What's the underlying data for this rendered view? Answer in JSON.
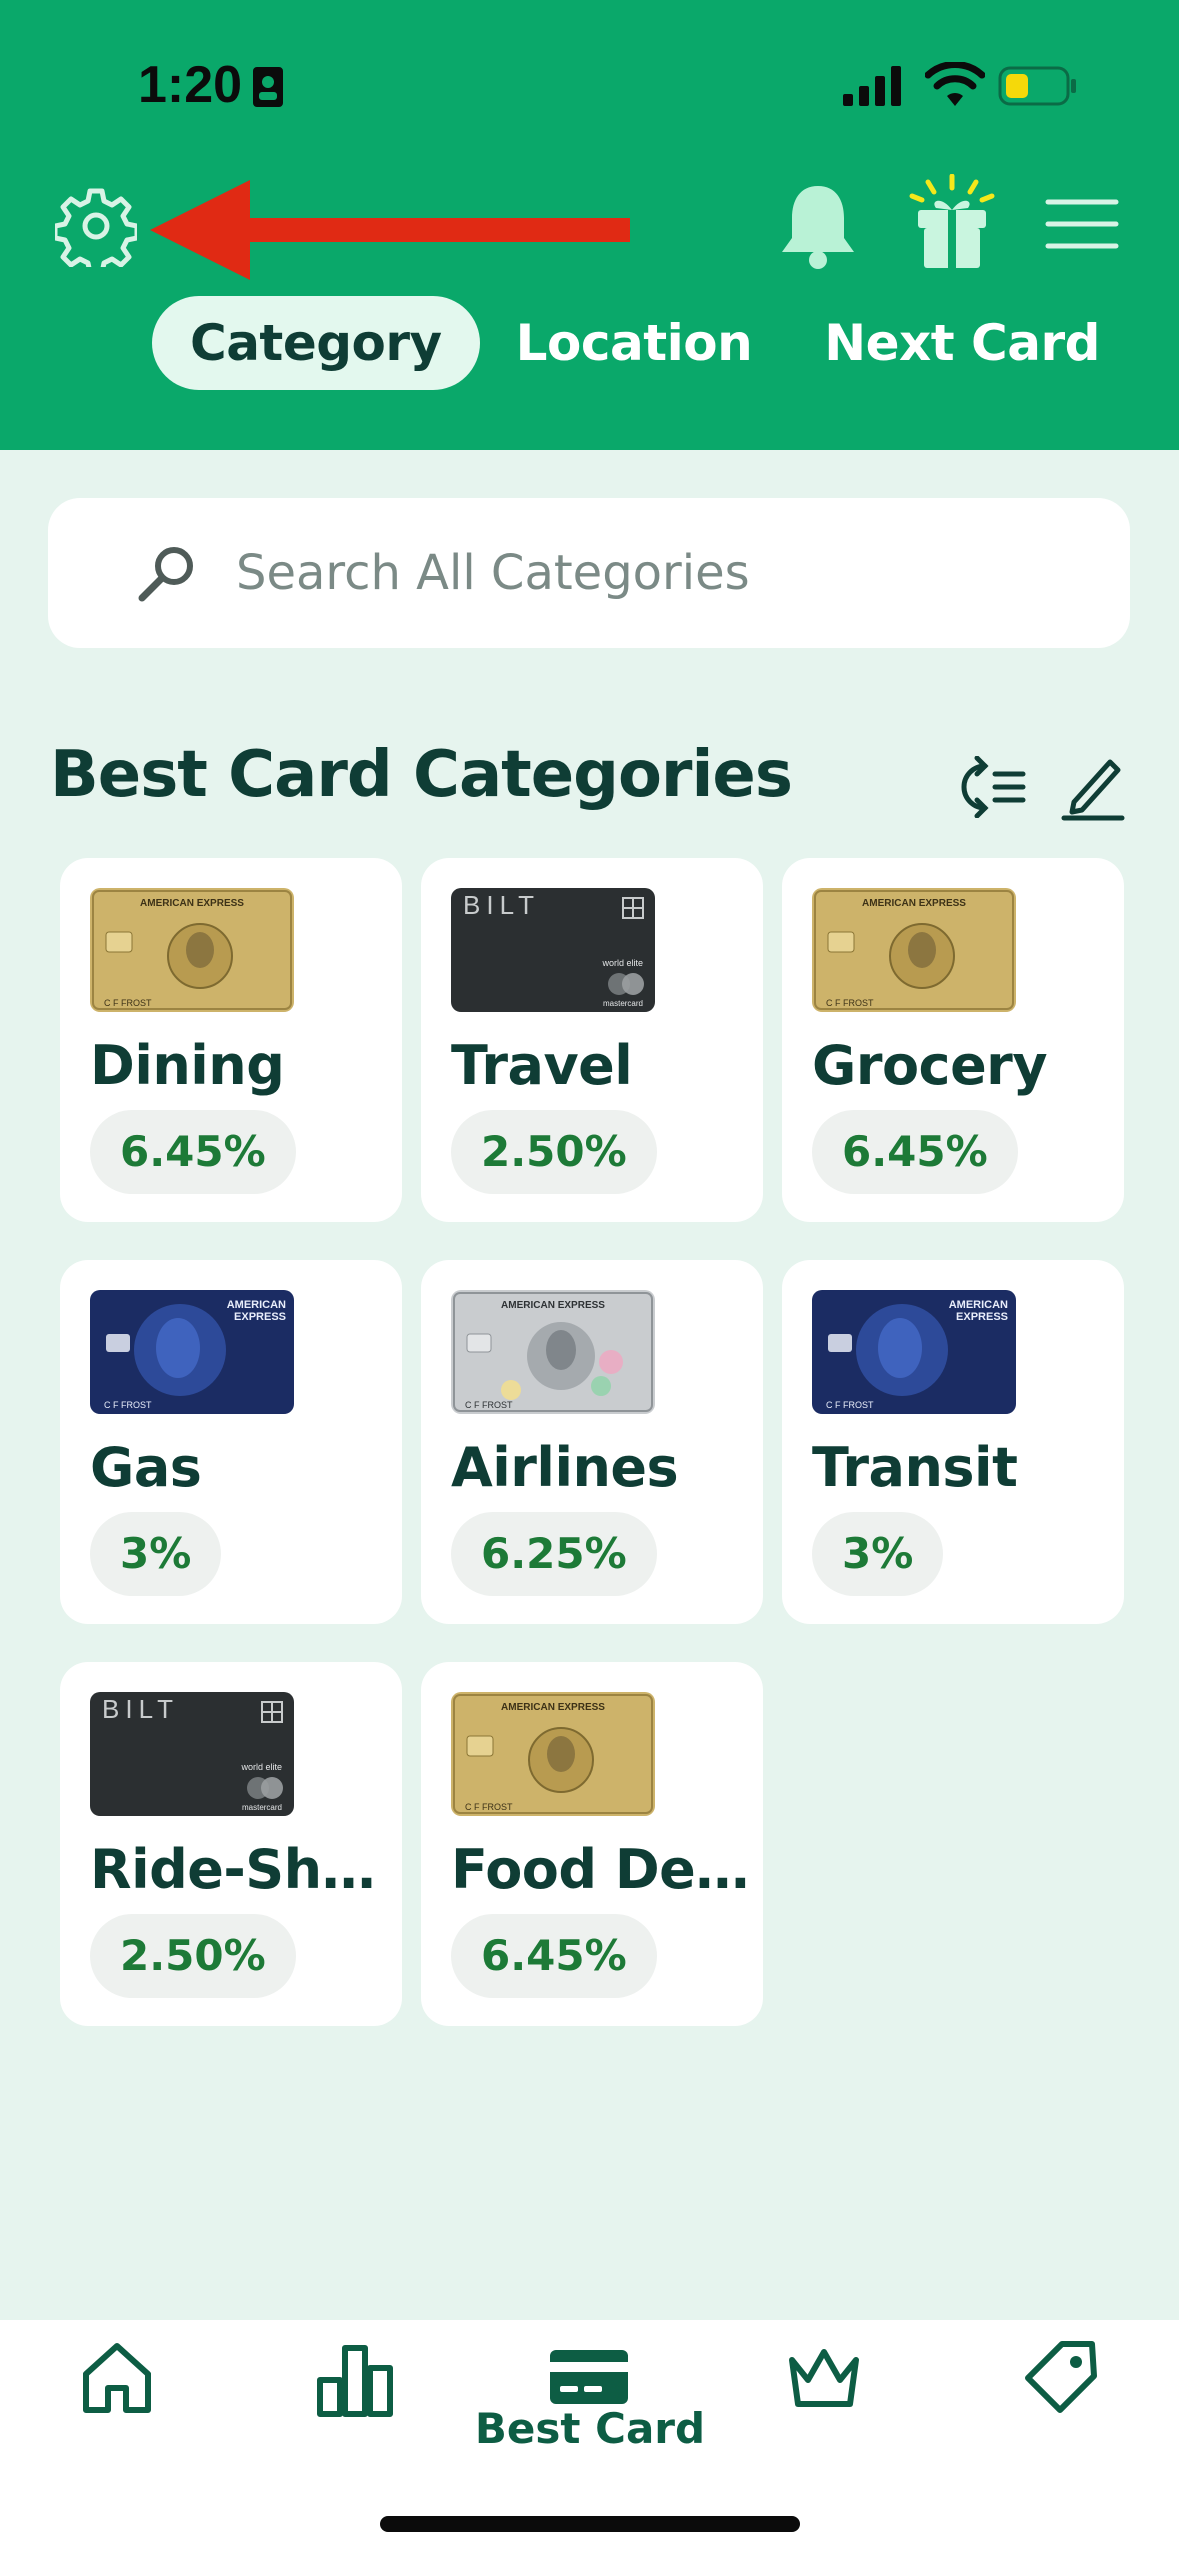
{
  "status_bar": {
    "time": "1:20"
  },
  "header": {
    "tabs": [
      {
        "label": "Category",
        "active": true
      },
      {
        "label": "Location",
        "active": false
      },
      {
        "label": "Next Card",
        "active": false
      }
    ]
  },
  "search": {
    "placeholder": "Search All Categories"
  },
  "section": {
    "title": "Best Card Categories"
  },
  "categories": [
    {
      "name": "Dining",
      "rate": "6.45%",
      "card": "amex-gold"
    },
    {
      "name": "Travel",
      "rate": "2.50%",
      "card": "bilt"
    },
    {
      "name": "Grocery",
      "rate": "6.45%",
      "card": "amex-gold"
    },
    {
      "name": "Gas",
      "rate": "3%",
      "card": "amex-blue"
    },
    {
      "name": "Airlines",
      "rate": "6.25%",
      "card": "amex-platinum"
    },
    {
      "name": "Transit",
      "rate": "3%",
      "card": "amex-blue"
    },
    {
      "name": "Ride-Sha…",
      "rate": "2.50%",
      "card": "bilt"
    },
    {
      "name": "Food Del…",
      "rate": "6.45%",
      "card": "amex-gold"
    }
  ],
  "card_art_text": {
    "amex": "AMERICAN EXPRESS",
    "bilt": "BILT",
    "bilt_tier": "world elite",
    "mastercard": "mastercard",
    "holder": "C F FROST"
  },
  "bottom_nav": {
    "items": [
      {
        "icon": "home-icon"
      },
      {
        "icon": "bar-chart-icon"
      },
      {
        "icon": "credit-card-icon",
        "label": "Best Card",
        "active": true
      },
      {
        "icon": "crown-icon"
      },
      {
        "icon": "tag-icon"
      }
    ]
  },
  "colors": {
    "header_green": "#0aa86a",
    "background_mint": "#e6f4ee",
    "text_dark": "#0f3d35",
    "rate_green": "#1d7a37",
    "annotation_red": "#e02a14"
  }
}
